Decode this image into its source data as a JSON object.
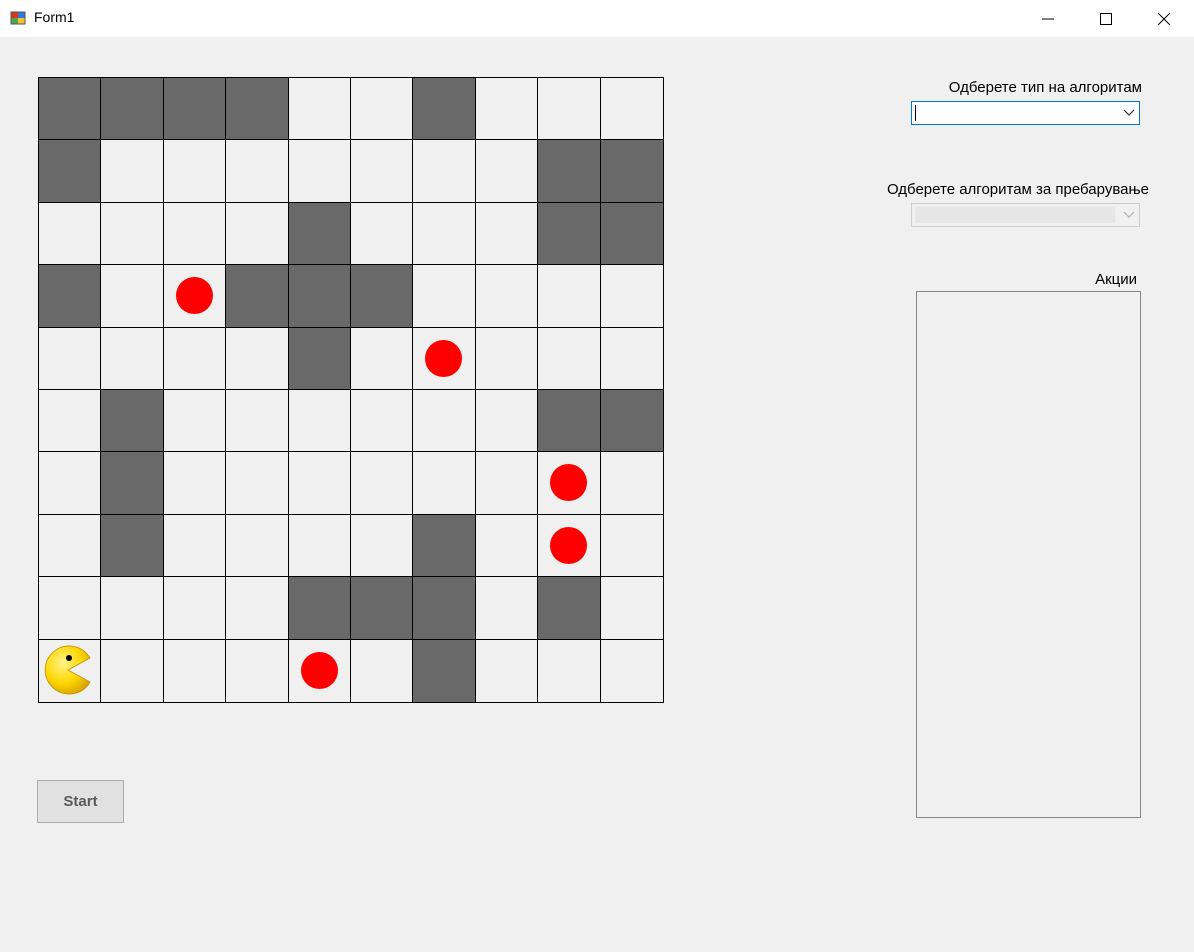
{
  "window": {
    "title": "Form1",
    "icon": "winforms-app-icon",
    "controls": [
      "minimize-icon",
      "maximize-icon",
      "close-icon"
    ]
  },
  "board": {
    "rows": 10,
    "cols": 10,
    "wall_color": "#696969",
    "empty_color": "#f0f0f0",
    "food_color": "#ff0000",
    "grid": [
      "WWWW..W...",
      "W.......WW",
      "....W...WW",
      "W.FWWW....",
      "....W.F...",
      ".W......WW",
      ".W......F.",
      ".W....W.F.",
      "....WWW.W.",
      "P...F.W..."
    ],
    "legend": {
      "W": "wall",
      ".": "empty",
      "F": "food",
      "P": "pacman"
    }
  },
  "controls": {
    "start_label": "Start",
    "type_label": "Одберете тип на алгоритам",
    "type_value": "",
    "search_label": "Одберете алгоритам за пребарување",
    "search_value": "",
    "actions_label": "Акции",
    "actions_items": []
  },
  "colors": {
    "pacman": "#ffd700",
    "focus_border": "#0078d7"
  }
}
